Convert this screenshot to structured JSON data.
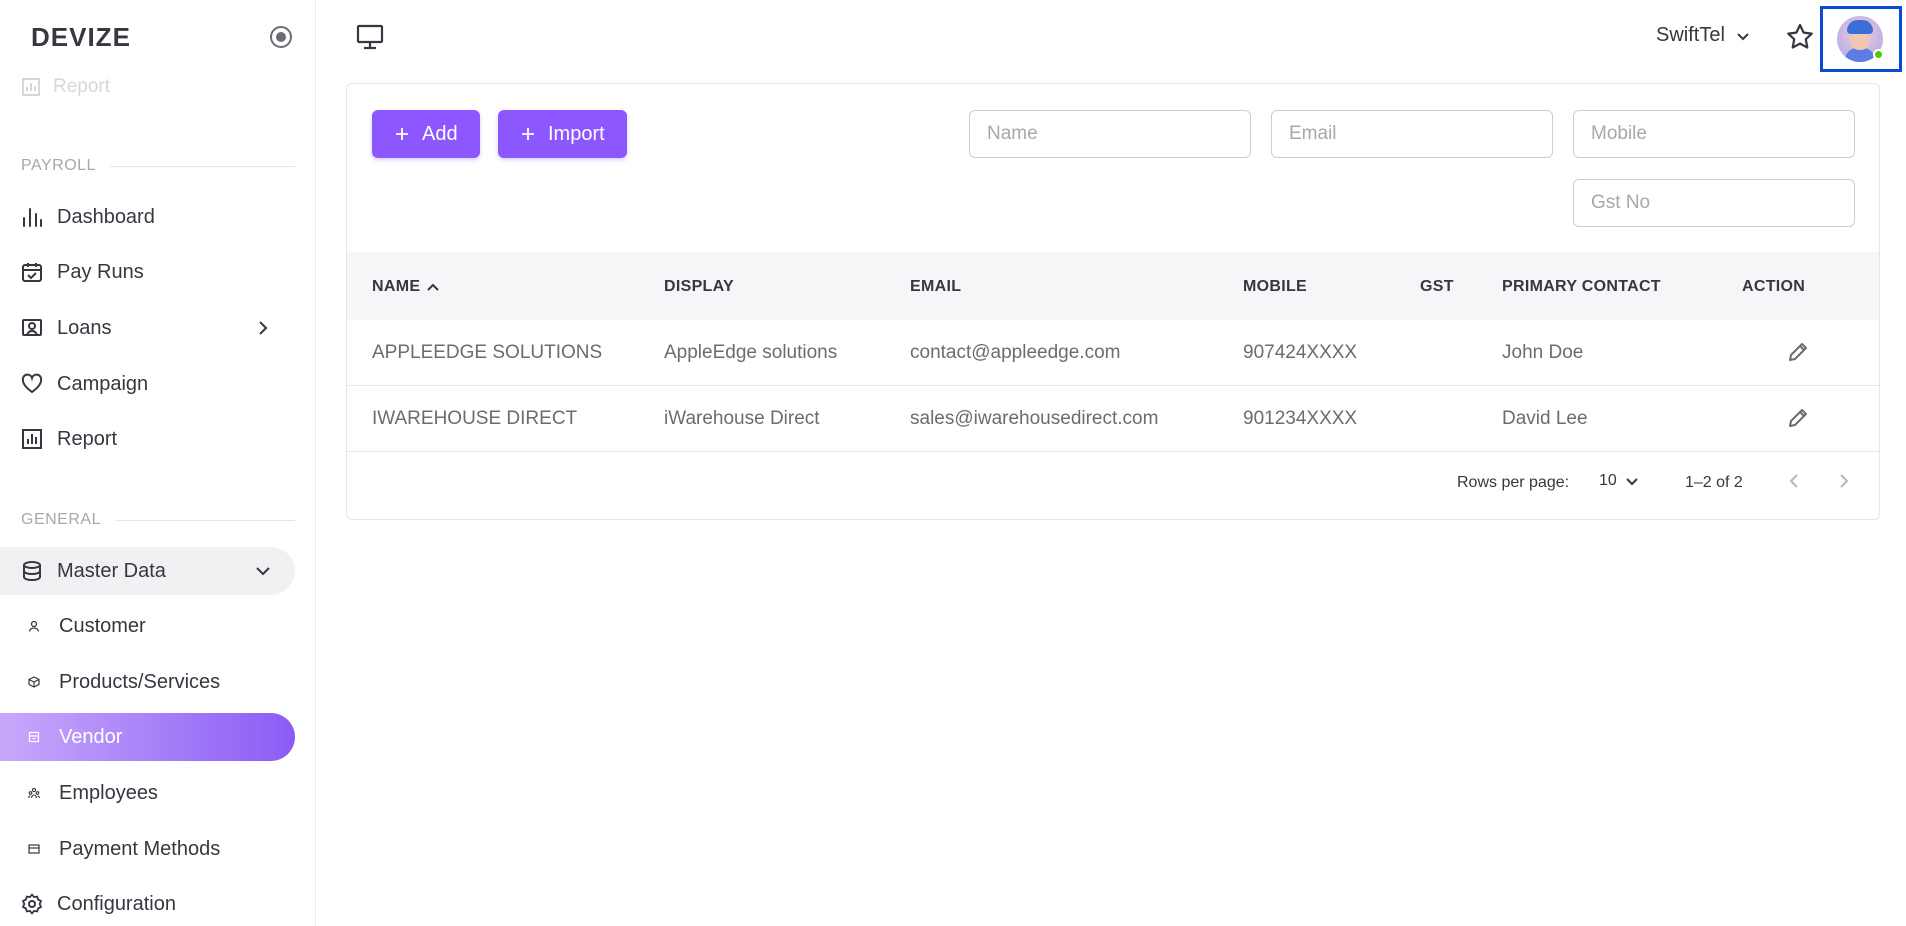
{
  "brand": "DEVIZE",
  "sidebar": {
    "faded_item": "Report",
    "payroll_section": "PAYROLL",
    "payroll_items": [
      {
        "label": "Dashboard",
        "icon": "bar-chart-icon"
      },
      {
        "label": "Pay Runs",
        "icon": "calendar-check-icon"
      },
      {
        "label": "Loans",
        "icon": "id-card-icon"
      },
      {
        "label": "Campaign",
        "icon": "heart-icon"
      },
      {
        "label": "Report",
        "icon": "report-chart-icon"
      }
    ],
    "general_section": "GENERAL",
    "master_data": "Master Data",
    "sub_items": [
      {
        "label": "Customer",
        "icon": "user-icon"
      },
      {
        "label": "Products/Services",
        "icon": "cube-icon"
      },
      {
        "label": "Vendor",
        "icon": "store-icon"
      },
      {
        "label": "Employees",
        "icon": "team-icon"
      },
      {
        "label": "Payment Methods",
        "icon": "card-icon"
      }
    ],
    "configuration": "Configuration"
  },
  "topbar": {
    "company": "SwiftTel"
  },
  "toolbar": {
    "add_label": "Add",
    "import_label": "Import"
  },
  "filters": {
    "name_placeholder": "Name",
    "email_placeholder": "Email",
    "mobile_placeholder": "Mobile",
    "gst_placeholder": "Gst No"
  },
  "table": {
    "headers": {
      "name": "NAME",
      "display": "DISPLAY",
      "email": "EMAIL",
      "mobile": "MOBILE",
      "gst": "GST",
      "primary_contact": "PRIMARY CONTACT",
      "action": "ACTION"
    },
    "rows": [
      {
        "name": "APPLEEDGE SOLUTIONS",
        "display": "AppleEdge solutions",
        "email": "contact@appleedge.com",
        "mobile": "907424XXXX",
        "gst": "",
        "contact": "John Doe"
      },
      {
        "name": "IWAREHOUSE DIRECT",
        "display": "iWarehouse Direct",
        "email": "sales@iwarehousedirect.com",
        "mobile": "901234XXXX",
        "gst": "",
        "contact": "David Lee"
      }
    ]
  },
  "pagination": {
    "rows_per_page_label": "Rows per page:",
    "rows_per_page": "10",
    "range": "1–2 of 2"
  },
  "colors": {
    "accent": "#8c57ff",
    "focus_outline": "#0a4bd1",
    "online": "#56ca00"
  }
}
